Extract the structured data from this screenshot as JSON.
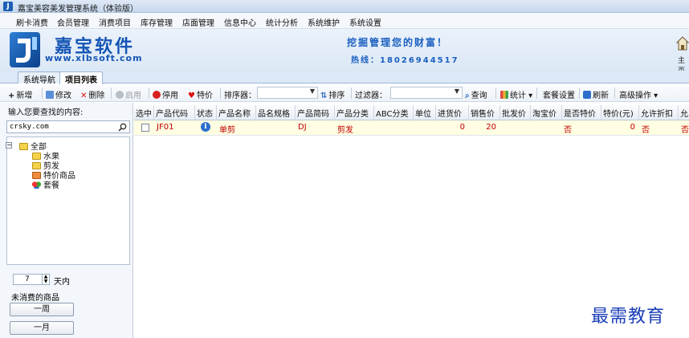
{
  "window": {
    "title": "嘉宝美容美发管理系统（体验版）",
    "app_icon": "J"
  },
  "menu": [
    "刷卡消费",
    "会员管理",
    "消费项目",
    "库存管理",
    "店面管理",
    "信息中心",
    "统计分析",
    "系统维护",
    "系统设置"
  ],
  "banner": {
    "brand": "嘉宝软件",
    "url": "www.xlbsoft.com",
    "slogan": "挖掘管理您的财富！",
    "hotline": "热线：18026944517",
    "home_label": "主页"
  },
  "tabs": [
    {
      "label": "系统导航",
      "active": false
    },
    {
      "label": "项目列表",
      "active": true
    }
  ],
  "toolbar": {
    "new": "新增",
    "edit": "修改",
    "delete": "删除",
    "enable": "启用",
    "disable": "停用",
    "special": "特价",
    "sorter_label": "排序器：",
    "sort": "排序",
    "filter_label": "过滤器：",
    "query": "查询",
    "stats": "统计",
    "package_setting": "套餐设置",
    "refresh": "刷新",
    "advanced": "高级操作"
  },
  "left": {
    "search_label": "输入您要查找的内容:",
    "search_value": "crsky.com",
    "tree": {
      "root": "全部",
      "children": [
        "水果",
        "剪发",
        "特价商品",
        "套餐"
      ]
    },
    "days_value": "7",
    "days_label": "天内",
    "unconsumed": "未消费的商品",
    "btn_week": "一周",
    "btn_month": "一月"
  },
  "grid": {
    "columns": [
      "选中",
      "产品代码",
      "状态",
      "产品名称",
      "品名规格",
      "产品简码",
      "产品分类",
      "ABC分类",
      "单位",
      "进货价",
      "销售价",
      "批发价",
      "淘宝价",
      "是否特价",
      "特价(元)",
      "允许折扣",
      "允"
    ],
    "rows": [
      {
        "selected": false,
        "code": "JF01",
        "status_icon": "info-icon",
        "name": "单剪",
        "spec": "",
        "short_code": "DJ",
        "category": "剪发",
        "abc": "",
        "unit": "",
        "purchase_price": "0",
        "sale_price": "20",
        "wholesale_price": "",
        "taobao_price": "",
        "is_special": "否",
        "special_price": "0",
        "allow_discount": "否",
        "extra": "否"
      }
    ]
  },
  "watermark": "最需教育"
}
